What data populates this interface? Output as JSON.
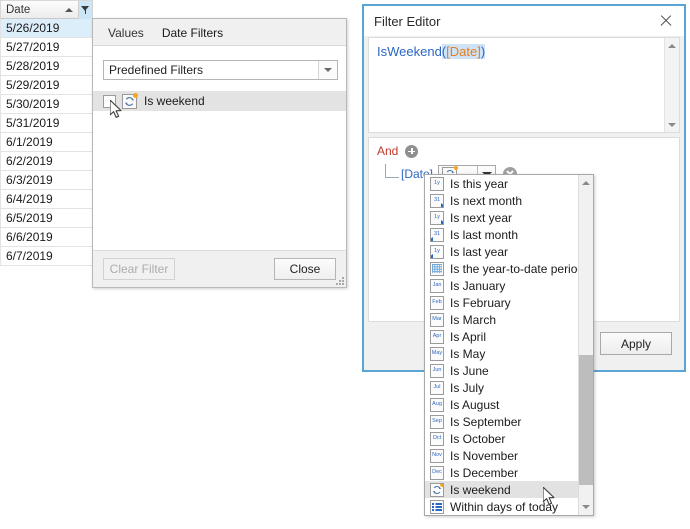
{
  "grid": {
    "column_header": "Date",
    "sort_indicator": "ascending",
    "rows": [
      "5/26/2019",
      "5/27/2019",
      "5/28/2019",
      "5/29/2019",
      "5/30/2019",
      "5/31/2019",
      "6/1/2019",
      "6/2/2019",
      "6/3/2019",
      "6/4/2019",
      "6/5/2019",
      "6/6/2019",
      "6/7/2019"
    ],
    "selected_row_index": 0
  },
  "filter_popup": {
    "tabs": [
      {
        "label": "Values",
        "active": false
      },
      {
        "label": "Date Filters",
        "active": true
      }
    ],
    "combo": {
      "value": "Predefined Filters"
    },
    "predefined_items": [
      {
        "label": "Is weekend",
        "checked": false,
        "icon": "weekend-icon",
        "highlighted": true
      }
    ],
    "footer": {
      "clear_filter_label": "Clear Filter",
      "clear_filter_disabled": true,
      "close_label": "Close"
    }
  },
  "filter_editor": {
    "title": "Filter Editor",
    "close_icon": "close-icon",
    "expression": {
      "function": "IsWeekend",
      "open_paren": "(",
      "field": "[Date]",
      "close_paren": ")"
    },
    "tree": {
      "group_operator": "And",
      "add_icon": "plus-icon",
      "condition": {
        "field": "[Date]",
        "operator_icon": "weekend-icon",
        "operator_dots": "...",
        "dropdown_icon": "chevron-down-icon",
        "delete_icon": "remove-icon"
      }
    },
    "footer": {
      "apply_label": "Apply"
    },
    "accent_color": "#5ba4d6"
  },
  "operator_dropdown": {
    "items": [
      {
        "label": "Is this year",
        "icon": "year-icon",
        "icon_text": "1y",
        "hover": false
      },
      {
        "label": "Is next month",
        "icon": "next-month-icon",
        "icon_text": "31",
        "arrow": "right",
        "hover": false
      },
      {
        "label": "Is next year",
        "icon": "next-year-icon",
        "icon_text": "1y",
        "arrow": "right",
        "hover": false
      },
      {
        "label": "Is last month",
        "icon": "last-month-icon",
        "icon_text": "31",
        "arrow": "left",
        "hover": false
      },
      {
        "label": "Is last year",
        "icon": "last-year-icon",
        "icon_text": "1y",
        "arrow": "left",
        "hover": false
      },
      {
        "label": "Is the year-to-date period",
        "icon": "ytd-icon",
        "icon_text": "",
        "hover": false
      },
      {
        "label": "Is January",
        "icon": "month-jan-icon",
        "icon_text": "Jan",
        "hover": false
      },
      {
        "label": "Is February",
        "icon": "month-feb-icon",
        "icon_text": "Feb",
        "hover": false
      },
      {
        "label": "Is March",
        "icon": "month-mar-icon",
        "icon_text": "Mar",
        "hover": false
      },
      {
        "label": "Is April",
        "icon": "month-apr-icon",
        "icon_text": "Apr",
        "hover": false
      },
      {
        "label": "Is May",
        "icon": "month-may-icon",
        "icon_text": "May",
        "hover": false
      },
      {
        "label": "Is June",
        "icon": "month-jun-icon",
        "icon_text": "Jun",
        "hover": false
      },
      {
        "label": "Is July",
        "icon": "month-jul-icon",
        "icon_text": "Jul",
        "hover": false
      },
      {
        "label": "Is August",
        "icon": "month-aug-icon",
        "icon_text": "Aug",
        "hover": false
      },
      {
        "label": "Is September",
        "icon": "month-sep-icon",
        "icon_text": "Sep",
        "hover": false
      },
      {
        "label": "Is October",
        "icon": "month-oct-icon",
        "icon_text": "Oct",
        "hover": false
      },
      {
        "label": "Is November",
        "icon": "month-nov-icon",
        "icon_text": "Nov",
        "hover": false
      },
      {
        "label": "Is December",
        "icon": "month-dec-icon",
        "icon_text": "Dec",
        "hover": false
      },
      {
        "label": "Is weekend",
        "icon": "weekend-icon",
        "icon_text": "",
        "hover": true
      },
      {
        "label": "Within days of today",
        "icon": "within-days-icon",
        "icon_text": "",
        "hover": false
      }
    ],
    "scroll_up_icon": "chevron-up-icon",
    "scroll_down_icon": "chevron-down-icon"
  }
}
